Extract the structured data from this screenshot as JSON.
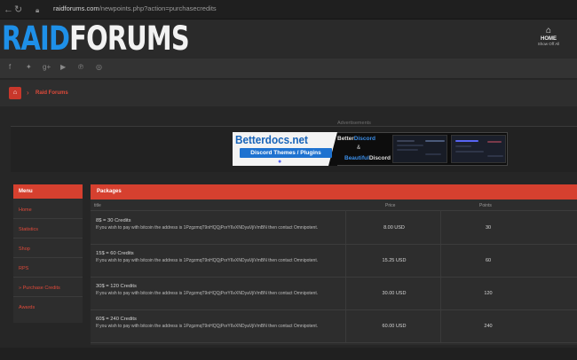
{
  "browser": {
    "url_domain": "raidforums.com",
    "url_path": "/newpoints.php?action=purchasecredits"
  },
  "header": {
    "logo_part1": "RAID",
    "logo_part2": "FORUMS",
    "home_label": "HOME",
    "home_sub": "Show Off All"
  },
  "breadcrumb": {
    "current": "Raid Forums"
  },
  "ad": {
    "label": "Advertisements",
    "title": "Betterdocs.net",
    "subtitle": "Discord Themes / Plugins",
    "mid_top_a": "Better",
    "mid_top_b": "Discord",
    "amp": "&",
    "mid_bot_a": "Beautiful",
    "mid_bot_b": "Discord"
  },
  "menu": {
    "heading": "Menu",
    "items": [
      {
        "label": "Home"
      },
      {
        "label": "Statistics"
      },
      {
        "label": "Shop"
      },
      {
        "label": "RPS"
      },
      {
        "label": "» Purchase Credits"
      },
      {
        "label": "Awards"
      }
    ]
  },
  "packages": {
    "heading": "Packages",
    "columns": {
      "title": "title",
      "price": "Price",
      "points": "Points"
    },
    "rows": [
      {
        "title": "8$ = 30 Credits",
        "desc": "If you wish to pay with bitcoin the address is 1PzgzmqT9nHQQjPorY6vXNDyaVjiVmBN then contact Omnipotent.",
        "price": "8.00 USD",
        "points": "30"
      },
      {
        "title": "15$ = 60 Credits",
        "desc": "If you wish to pay with bitcoin the address is 1PzgzmqT9nHQQjPorY6vXNDyaVjiVmBN then contact Omnipotent.",
        "price": "15.25 USD",
        "points": "60"
      },
      {
        "title": "30$ = 120 Credits",
        "desc": "If you wish to pay with bitcoin the address is 1PzgzmqT9nHQQjPorY6vXNDyaVjiVmBN then contact Omnipotent.",
        "price": "30.00 USD",
        "points": "120"
      },
      {
        "title": "60$ = 240 Credits",
        "desc": "If you wish to pay with bitcoin the address is 1PzgzmqT9nHQQjPorY6vXNDyaVjiVmBN then contact Omnipotent.",
        "price": "60.00 USD",
        "points": "240"
      }
    ]
  },
  "icons": {
    "back": "back-arrow-icon",
    "reload": "reload-icon",
    "lock": "lock-icon",
    "home": "home-icon",
    "social": [
      "facebook-icon",
      "twitter-icon",
      "google-plus-icon",
      "youtube-icon",
      "pinterest-icon",
      "dribbble-icon"
    ]
  },
  "colors": {
    "accent": "#d6402f",
    "logo_blue": "#1e90e8",
    "link_red": "#e04a3a"
  }
}
